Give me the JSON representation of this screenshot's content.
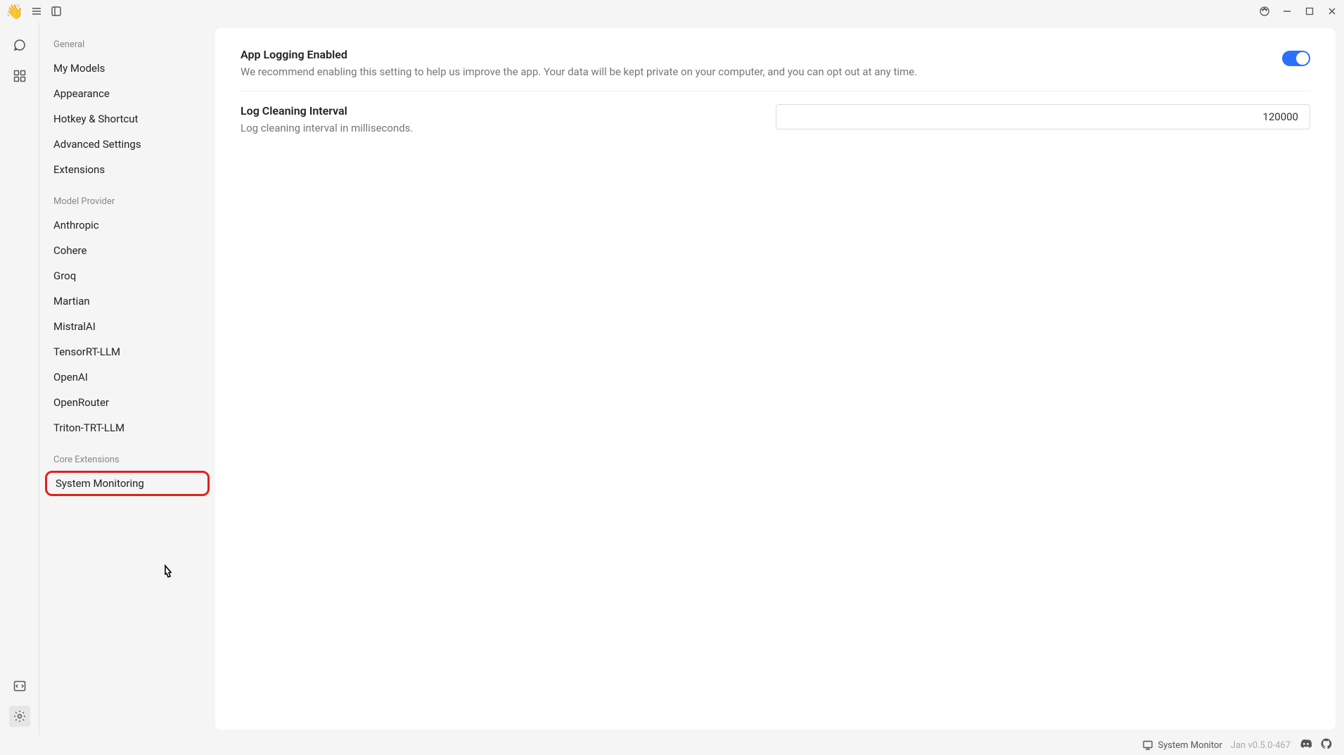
{
  "titlebar": {
    "logo": "👋"
  },
  "sidebar": {
    "sections": [
      {
        "header": "General",
        "items": [
          "My Models",
          "Appearance",
          "Hotkey & Shortcut",
          "Advanced Settings",
          "Extensions"
        ]
      },
      {
        "header": "Model Provider",
        "items": [
          "Anthropic",
          "Cohere",
          "Groq",
          "Martian",
          "MistralAI",
          "TensorRT-LLM",
          "OpenAI",
          "OpenRouter",
          "Triton-TRT-LLM"
        ]
      },
      {
        "header": "Core Extensions",
        "items": [
          "System Monitoring"
        ]
      }
    ]
  },
  "settings": {
    "logging": {
      "title": "App Logging Enabled",
      "desc": "We recommend enabling this setting to help us improve the app. Your data will be kept private on your computer, and you can opt out at any time.",
      "enabled": true
    },
    "interval": {
      "title": "Log Cleaning Interval",
      "desc": "Log cleaning interval in milliseconds.",
      "value": "120000"
    }
  },
  "statusbar": {
    "monitor": "System Monitor",
    "version": "Jan v0.5.0-467"
  }
}
